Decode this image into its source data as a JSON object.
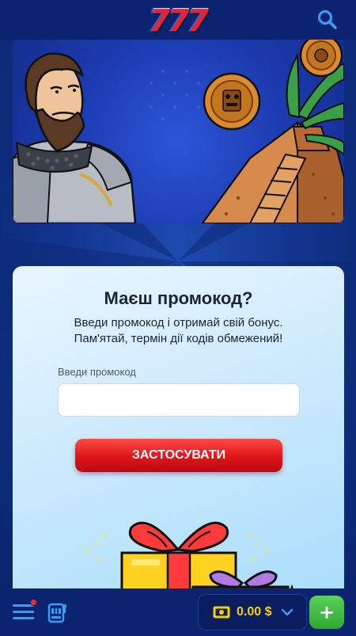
{
  "header": {
    "logo_text": "777",
    "search_icon": "search-icon"
  },
  "promo": {
    "title": "Маєш промокод?",
    "subtitle_line1": "Введи промокод і отримай свій бонус.",
    "subtitle_line2": "Пам'ятай, термін дії кодів обмежений!",
    "input_label": "Введи промокод",
    "input_value": "",
    "input_placeholder": "",
    "apply_label": "ЗАСТОСУВАТИ"
  },
  "bottom_nav": {
    "menu_icon": "hamburger-menu-icon",
    "slot_icon": "slot-machine-icon",
    "cash_icon": "cash-icon",
    "balance": "0.00 $",
    "deposit_label": "+",
    "has_notification": true
  },
  "colors": {
    "header_bg": "#0c2470",
    "accent_blue": "#3a9df4",
    "apply_red": "#e0141b",
    "balance_yellow": "#f8d000",
    "deposit_green": "#2fa92f",
    "notification_red": "#ff2b2b"
  }
}
